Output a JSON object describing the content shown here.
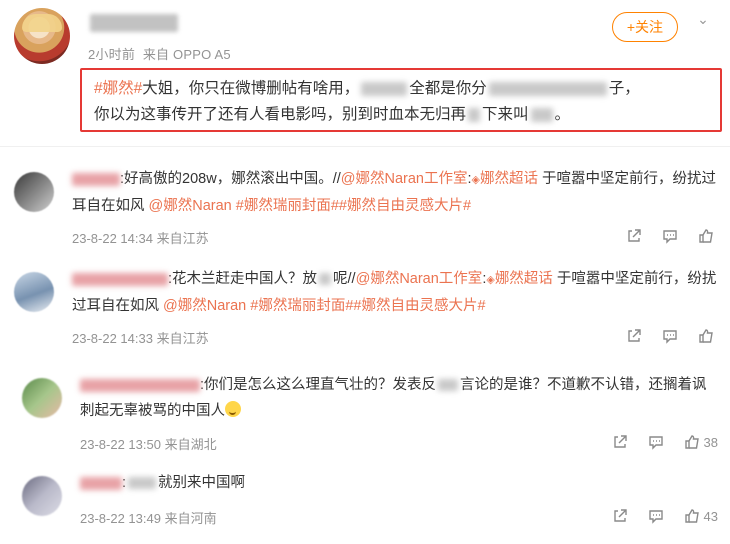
{
  "post": {
    "meta": {
      "time": "2小时前",
      "source": "来自 OPPO A5"
    },
    "follow_label": "+关注",
    "body": {
      "hashtag": "#娜然#",
      "text_a": "大姐，你只在微博删帖有啥用，",
      "text_b": "全都是你分",
      "text_c": "子，",
      "text_d": "你以为这事传开了还有人看电影吗，别到时血本无归再",
      "text_e": "下来叫",
      "text_f": "。"
    }
  },
  "comments": [
    {
      "text_prefix": ":好高傲的208w，娜然滚出中国。//",
      "mention_studio": "@娜然Naran工作室",
      "colon": ":",
      "super_topic": "娜然超话",
      "text_mid": " 于喧嚣中坚定前行，纷扰过耳自在如风 ",
      "mention_user": "@娜然Naran",
      "tags": " #娜然瑞丽封面##娜然自由灵感大片#",
      "time": "23-8-22 14:34",
      "location": "来自江苏",
      "likes": ""
    },
    {
      "text_prefix": ":花木兰赶走中国人？放",
      "text_prefix2": "呢//",
      "mention_studio": "@娜然Naran工作室",
      "colon": ":",
      "super_topic": "娜然超话",
      "text_mid": " 于喧嚣中坚定前行，纷扰过耳自在如风 ",
      "mention_user": "@娜然Naran",
      "tags": " #娜然瑞丽封面##娜然自由灵感大片#",
      "time": "23-8-22 14:33",
      "location": "来自江苏",
      "likes": ""
    },
    {
      "text_prefix": ":你们是怎么这么理直气壮的？发表反",
      "text_prefix2": "言论的是谁？不道歉不认错，还搁着讽刺起无辜被骂的中国人",
      "time": "23-8-22 13:50",
      "location": "来自湖北",
      "likes": "38"
    },
    {
      "text_prefix": ":",
      "text_prefix2": "就别来中国啊",
      "time": "23-8-22 13:49",
      "location": "来自河南",
      "likes": "43"
    }
  ],
  "icons": {
    "share": "share-icon",
    "comment": "comment-icon",
    "like": "like-icon"
  },
  "colors": {
    "accent": "#ff8200",
    "link": "#eb7350",
    "highlight_border": "#e53935",
    "meta": "#939393"
  }
}
